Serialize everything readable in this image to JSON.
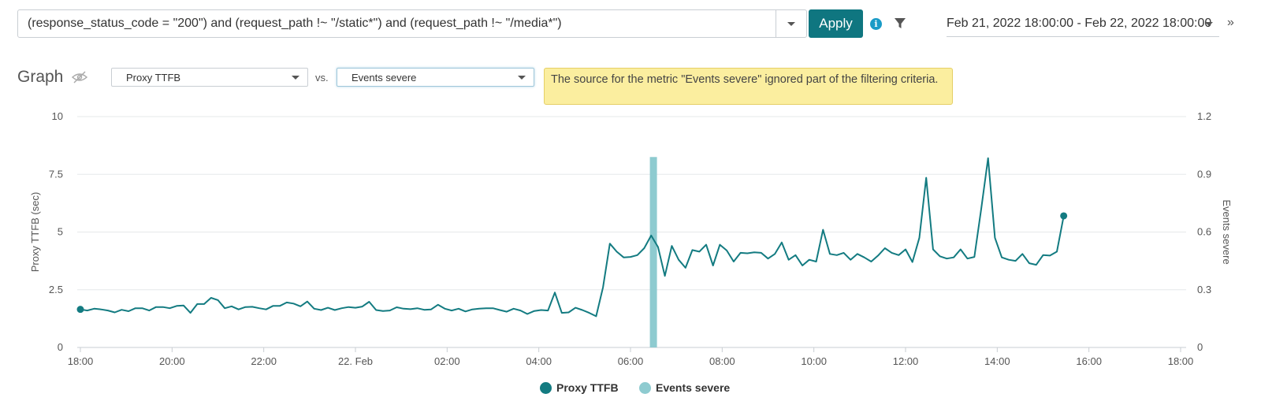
{
  "filter": {
    "query": "(response_status_code = \"200\") and (request_path !~ \"/static*\") and (request_path !~ \"/media*\")",
    "apply_label": "Apply",
    "date_range": "Feb 21, 2022 18:00:00 - Feb 22, 2022 18:00:00"
  },
  "graph": {
    "title": "Graph",
    "metric_primary": "Proxy TTFB",
    "vs_label": "vs.",
    "metric_secondary": "Events severe",
    "warning": "The source for the metric \"Events severe\" ignored part of the filtering criteria."
  },
  "icons": {
    "info": "info-icon",
    "filter": "funnel-icon",
    "visibility": "eye-slash-icon",
    "expand": "double-chevron-right-icon"
  },
  "colors": {
    "accent": "#0f7680",
    "line": "#137b81",
    "bar": "#8ecbd0",
    "warning_bg": "#fbee9f",
    "info": "#1a9bc7"
  },
  "chart_data": {
    "type": "line",
    "grid": true,
    "legend_position": "bottom-center",
    "x_unit": "hours since Feb 21 18:00",
    "x_ticks": [
      {
        "pos": 0,
        "label": "18:00"
      },
      {
        "pos": 2,
        "label": "20:00"
      },
      {
        "pos": 4,
        "label": "22:00"
      },
      {
        "pos": 6,
        "label": "22. Feb"
      },
      {
        "pos": 8,
        "label": "02:00"
      },
      {
        "pos": 10,
        "label": "04:00"
      },
      {
        "pos": 12,
        "label": "06:00"
      },
      {
        "pos": 14,
        "label": "08:00"
      },
      {
        "pos": 16,
        "label": "10:00"
      },
      {
        "pos": 18,
        "label": "12:00"
      },
      {
        "pos": 20,
        "label": "14:00"
      },
      {
        "pos": 22,
        "label": "16:00"
      },
      {
        "pos": 24,
        "label": "18:00"
      }
    ],
    "xlim": [
      0,
      24
    ],
    "y_left": {
      "label": "Proxy TTFB (sec)",
      "lim": [
        0,
        10
      ],
      "ticks": [
        "0",
        "2.5",
        "5",
        "7.5",
        "10"
      ]
    },
    "y_right": {
      "label": "Events severe",
      "lim": [
        0,
        1.2
      ],
      "ticks": [
        "0",
        "0.3",
        "0.6",
        "0.9",
        "1.2"
      ]
    },
    "series": [
      {
        "name": "Proxy TTFB",
        "axis": "left",
        "x_start": 0,
        "x_step": 0.15,
        "values": [
          1.65,
          1.6,
          1.68,
          1.65,
          1.6,
          1.52,
          1.63,
          1.57,
          1.7,
          1.7,
          1.6,
          1.75,
          1.75,
          1.7,
          1.8,
          1.82,
          1.5,
          1.88,
          1.88,
          2.15,
          2.05,
          1.7,
          1.78,
          1.65,
          1.75,
          1.76,
          1.7,
          1.65,
          1.8,
          1.8,
          1.95,
          1.9,
          1.78,
          1.99,
          1.68,
          1.62,
          1.72,
          1.62,
          1.7,
          1.75,
          1.72,
          1.77,
          1.98,
          1.62,
          1.58,
          1.6,
          1.74,
          1.68,
          1.66,
          1.7,
          1.63,
          1.65,
          1.85,
          1.68,
          1.6,
          1.68,
          1.56,
          1.65,
          1.68,
          1.7,
          1.7,
          1.62,
          1.55,
          1.68,
          1.6,
          1.45,
          1.58,
          1.62,
          1.6,
          2.38,
          1.5,
          1.52,
          1.72,
          1.62,
          1.5,
          1.35,
          2.6,
          4.5,
          4.15,
          3.9,
          3.92,
          4.0,
          4.3,
          4.85,
          4.35,
          3.1,
          4.4,
          3.8,
          3.45,
          4.22,
          4.15,
          4.45,
          3.55,
          4.45,
          4.2,
          3.72,
          4.1,
          4.08,
          4.12,
          4.1,
          3.85,
          4.05,
          4.55,
          3.8,
          4.0,
          3.55,
          3.8,
          3.72,
          5.1,
          4.05,
          4.0,
          4.1,
          3.8,
          4.05,
          3.9,
          3.72,
          3.98,
          4.3,
          4.1,
          4.0,
          4.25,
          3.7,
          4.75,
          7.35,
          4.25,
          3.95,
          3.85,
          3.9,
          4.25,
          3.85,
          3.92,
          6.0,
          8.2,
          4.75,
          3.9,
          3.8,
          3.75,
          4.05,
          3.65,
          3.58,
          4.0,
          3.98,
          4.15,
          5.7
        ]
      },
      {
        "name": "Events severe",
        "axis": "right",
        "type": "bar",
        "x": [
          12.5
        ],
        "values": [
          0.99
        ]
      }
    ]
  }
}
